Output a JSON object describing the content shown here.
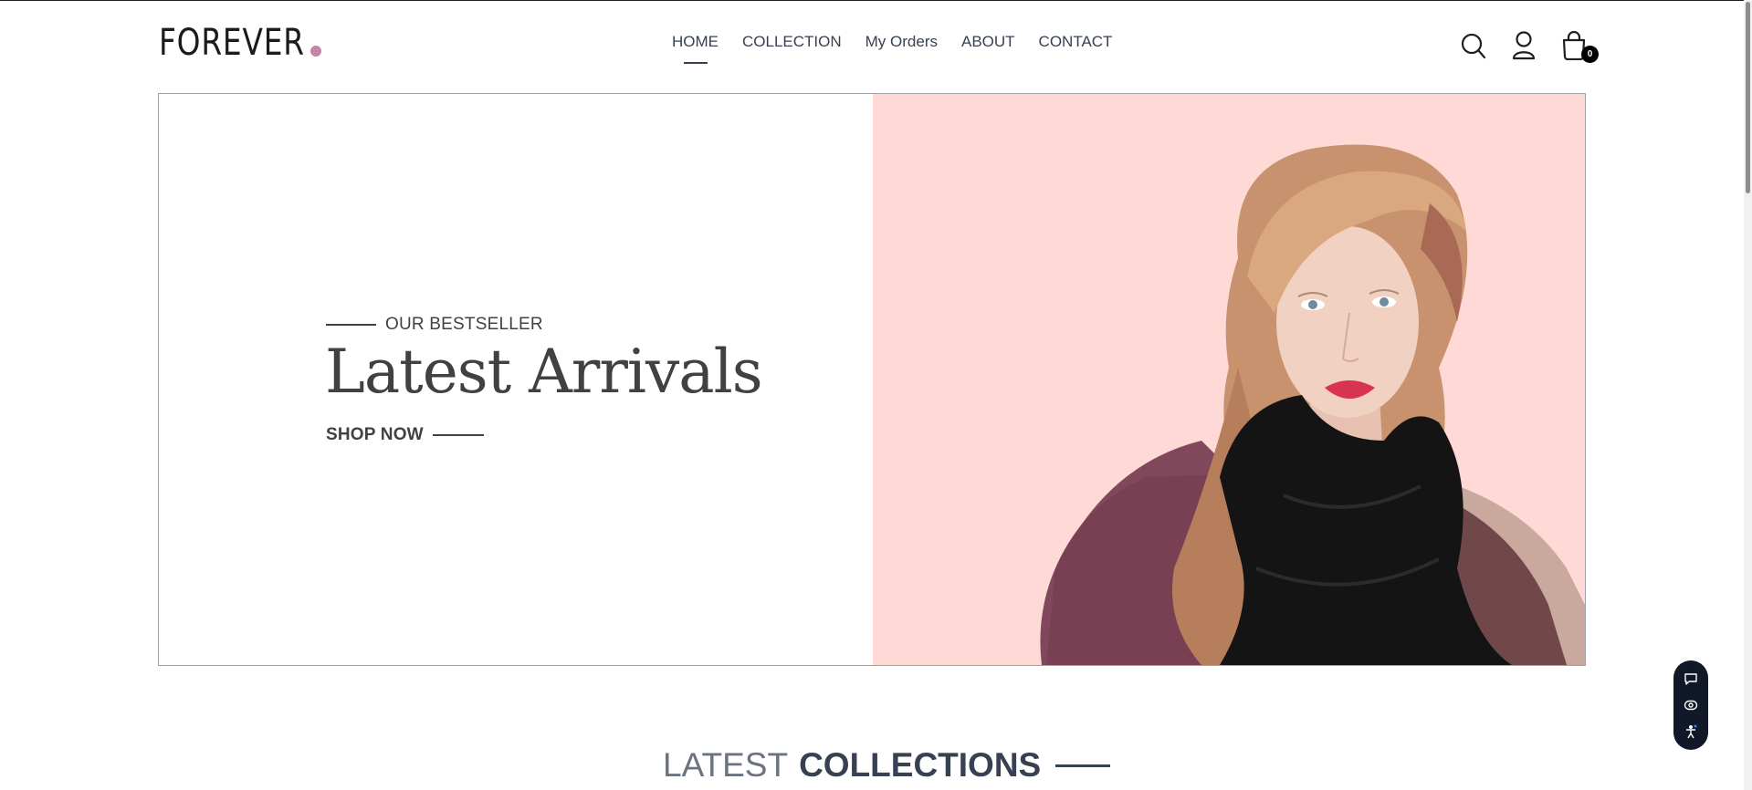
{
  "header": {
    "logo_text": "FOREVER",
    "nav": [
      {
        "label": "HOME",
        "active": true
      },
      {
        "label": "COLLECTION"
      },
      {
        "label": "My Orders"
      },
      {
        "label": "ABOUT"
      },
      {
        "label": "CONTACT"
      }
    ],
    "icons": [
      "search-icon",
      "profile-icon",
      "cart-icon"
    ],
    "cart_count": "0"
  },
  "hero": {
    "tagline": "OUR BESTSELLER",
    "title": "Latest Arrivals",
    "cta": "SHOP NOW",
    "image_background": "#ffd9d6"
  },
  "section": {
    "title_light": "LATEST",
    "title_bold": "COLLECTIONS"
  },
  "widget": {
    "buttons": [
      "chat-icon",
      "eye-icon",
      "accessibility-icon"
    ]
  },
  "colors": {
    "text": "#374151",
    "logo_dot": "#c586a5",
    "hero_pink": "#ffd9d6"
  }
}
